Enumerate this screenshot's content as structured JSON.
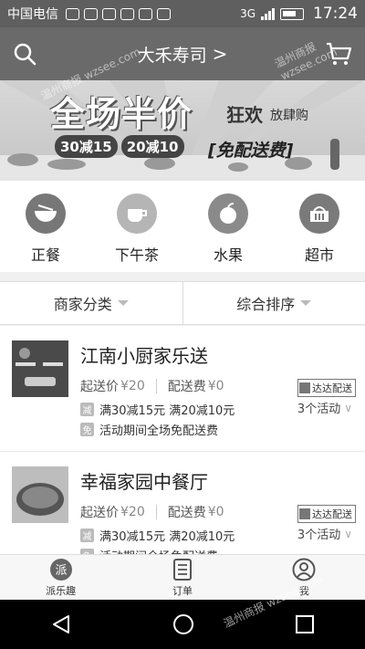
{
  "status_bar": {
    "carrier": "中国电信",
    "network": "3G",
    "time": "17:24"
  },
  "header": {
    "title": "大禾寿司",
    "chevron": ">",
    "icons": {
      "search": "search-icon",
      "cart": "cart-icon"
    }
  },
  "banner": {
    "title": "全场半价",
    "subtitle": "狂欢",
    "subtitle2": "放肆购",
    "tags": [
      "30减15",
      "20减10"
    ],
    "free_delivery": "[免配送费]"
  },
  "categories": [
    {
      "label": "正餐",
      "icon": "bowl-icon"
    },
    {
      "label": "下午茶",
      "icon": "teacup-icon"
    },
    {
      "label": "水果",
      "icon": "apple-icon"
    },
    {
      "label": "超市",
      "icon": "basket-icon"
    }
  ],
  "sort_bar": {
    "category_filter": "商家分类",
    "sort_order": "综合排序"
  },
  "stores": [
    {
      "name": "江南小厨家乐送",
      "min_label": "起送价",
      "min_value": "¥20",
      "fee_label": "配送费",
      "fee_value": "¥0",
      "delivery_badge": "达达配送",
      "activities": [
        {
          "icon": "减",
          "text": "满30减15元 满20减10元"
        },
        {
          "icon": "免",
          "text": "活动期间全场免配送费"
        }
      ],
      "activity_count": "3个活动"
    },
    {
      "name": "幸福家园中餐厅",
      "min_label": "起送价",
      "min_value": "¥20",
      "fee_label": "配送费",
      "fee_value": "¥0",
      "delivery_badge": "达达配送",
      "activities": [
        {
          "icon": "减",
          "text": "满30减15元 满20减10元"
        },
        {
          "icon": "免",
          "text": "活动期间全场免配送费"
        }
      ],
      "activity_count": "3个活动"
    }
  ],
  "bottom_nav": [
    {
      "label": "派乐趣",
      "icon": "pai-logo-icon",
      "glyph": "派"
    },
    {
      "label": "订单",
      "icon": "order-list-icon"
    },
    {
      "label": "我",
      "icon": "profile-icon"
    }
  ],
  "watermark": "温州商报 wzsee.com"
}
